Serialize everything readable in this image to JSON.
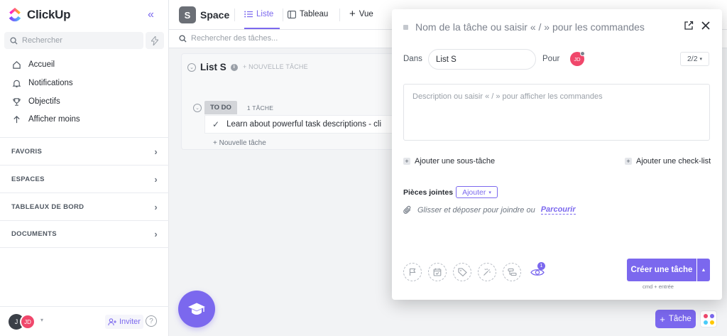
{
  "app": {
    "name": "ClickUp"
  },
  "sidebar": {
    "search_placeholder": "Rechercher",
    "nav": [
      {
        "label": "Accueil",
        "icon": "home-icon"
      },
      {
        "label": "Notifications",
        "icon": "bell-icon"
      },
      {
        "label": "Objectifs",
        "icon": "trophy-icon"
      },
      {
        "label": "Afficher moins",
        "icon": "arrow-up-icon"
      }
    ],
    "sections": [
      "FAVORIS",
      "ESPACES",
      "TABLEAUX DE BORD",
      "DOCUMENTS"
    ],
    "footer": {
      "avatar1": "J",
      "avatar2": "JD",
      "invite_label": "Inviter",
      "help": "?"
    }
  },
  "header": {
    "space_initial": "S",
    "space_name": "Space",
    "tabs": [
      {
        "label": "Liste",
        "active": true
      },
      {
        "label": "Tableau",
        "active": false
      },
      {
        "label": "Vue",
        "active": false
      }
    ],
    "task_search_placeholder": "Rechercher des tâches..."
  },
  "list": {
    "title": "List S",
    "new_task_label": "+ NOUVELLE TÂCHE",
    "status": "TO DO",
    "task_count": "1 TÂCHE",
    "task_title": "Learn about powerful task descriptions - cli",
    "add_task_label": "+ Nouvelle tâche"
  },
  "modal": {
    "name_placeholder": "Nom de la tâche ou saisir « / » pour les commandes",
    "in_label": "Dans",
    "list_value": "List S",
    "for_label": "Pour",
    "assignee_initials": "JD",
    "count_value": "2/2",
    "description_placeholder": "Description ou saisir « / » pour afficher les commandes",
    "add_subtask": "Ajouter une sous-tâche",
    "add_checklist": "Ajouter une check-list",
    "attachments_label": "Pièces jointes",
    "add_button": "Ajouter",
    "drop_text": "Glisser et déposer pour joindre ou",
    "browse_link": "Parcourir",
    "watchers_count": "1",
    "create_button": "Créer une tâche",
    "create_hint": "cmd + entrée"
  },
  "bottom": {
    "task_button": "Tâche"
  },
  "colors": {
    "accent": "#7b68ee",
    "avatar_pink": "#f0476b"
  }
}
